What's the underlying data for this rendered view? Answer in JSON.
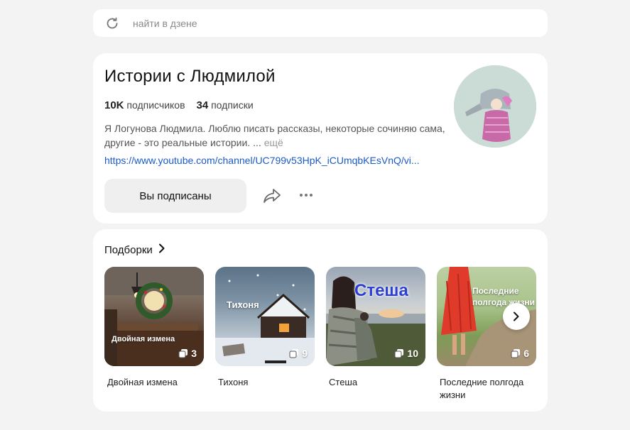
{
  "search": {
    "placeholder": "найти в дзене"
  },
  "channel": {
    "title": "Истории с Людмилой",
    "subscribers_count": "10K",
    "subscribers_label": "подписчиков",
    "subscriptions_count": "34",
    "subscriptions_label": "подписки",
    "description": "Я Логунова Людмила. Люблю писать рассказы, некоторые сочиняю сама, другие - это реальные истории. ...",
    "more_label": "ещё",
    "link": "https://www.youtube.com/channel/UC799v53HpK_iCUmqbKEsVnQ/vi...",
    "subscribed_button": "Вы подписаны"
  },
  "collections": {
    "heading": "Подборки",
    "items": [
      {
        "name": "Двойная измена",
        "cover_caption": "Двойная измена",
        "count": "3"
      },
      {
        "name": "Тихоня",
        "cover_caption": "Тихоня",
        "count": "9"
      },
      {
        "name": "Стеша",
        "cover_caption": "Стеша",
        "count": "10"
      },
      {
        "name": "Последние полгода жизни",
        "cover_caption": "Последние полгода жизни",
        "count": "6"
      }
    ]
  }
}
